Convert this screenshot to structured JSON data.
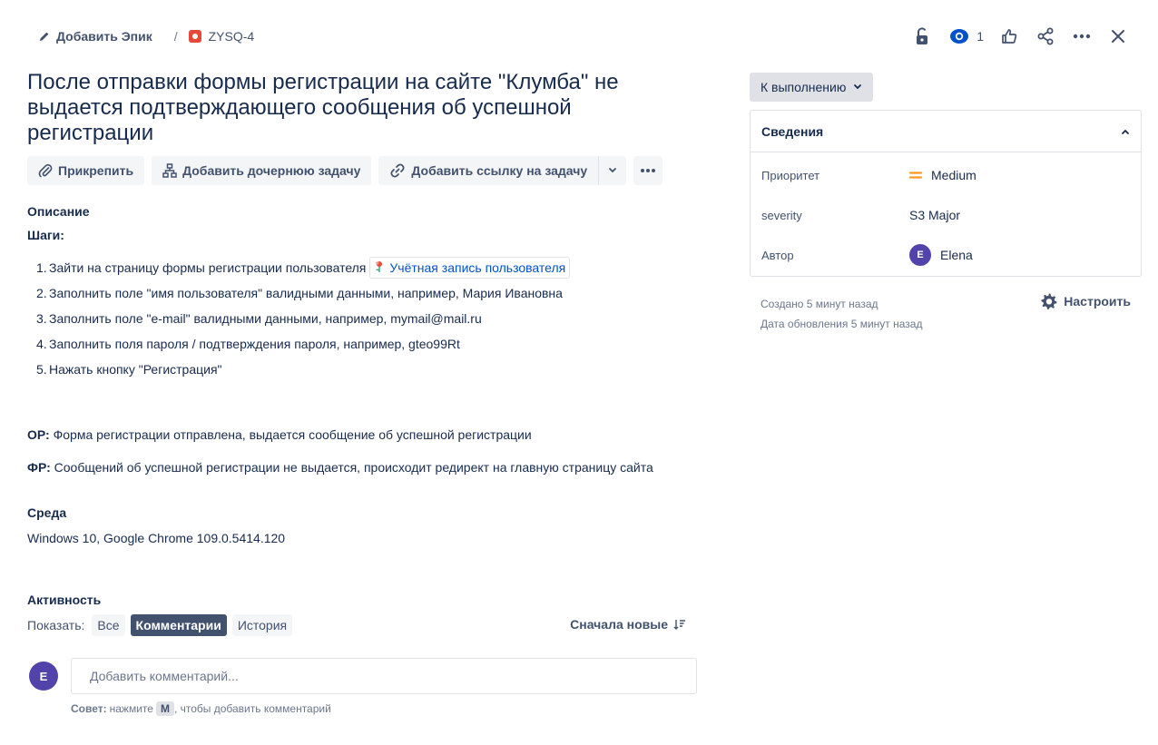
{
  "breadcrumb": {
    "add_epic_label": "Добавить Эпик",
    "separator": "/",
    "issue_key": "ZYSQ-4",
    "issue_type_icon": "bug-icon"
  },
  "header_actions": {
    "watch_count": "1",
    "icons": [
      "unlock-icon",
      "eye-icon",
      "thumbs-up-icon",
      "share-icon",
      "more-icon",
      "close-icon"
    ]
  },
  "issue": {
    "title": "После отправки формы регистрации на сайте \"Клумба\" не выдается подтверждающего сообщения об успешной регистрации"
  },
  "actions": {
    "attach": "Прикрепить",
    "add_child": "Добавить дочернюю задачу",
    "add_link": "Добавить ссылку на задачу"
  },
  "description": {
    "heading": "Описание",
    "steps_heading": "Шаги:",
    "steps": [
      {
        "num": "1.",
        "text": "Зайти на страницу формы регистрации пользователя",
        "link": "Учётная запись пользователя"
      },
      {
        "num": "2.",
        "text": "Заполнить поле \"имя пользователя\" валидными данными, например, Мария Ивановна"
      },
      {
        "num": "3.",
        "text": "Заполнить поле \"e-mail\" валидными данными, например, mymail@mail.ru"
      },
      {
        "num": "4.",
        "text": "Заполнить поля пароля / подтверждения пароля, например, gteo99Rt"
      },
      {
        "num": "5.",
        "text": "Нажать кнопку \"Регистрация\""
      }
    ],
    "expected_label": "ОР:",
    "expected_text": "Форма регистрации отправлена, выдается сообщение об успешной регистрации",
    "actual_label": "ФР:",
    "actual_text": "Сообщений об успешной регистрации не выдается, происходит редирект на главную страницу сайта"
  },
  "environment": {
    "heading": "Среда",
    "value": "Windows 10, Google Chrome 109.0.5414.120"
  },
  "activity": {
    "heading": "Активность",
    "show_label": "Показать:",
    "filters": [
      "Все",
      "Комментарии",
      "История"
    ],
    "active_filter": "Комментарии",
    "sort_label": "Сначала новые",
    "avatar_initial": "E",
    "comment_placeholder": "Добавить комментарий...",
    "tip_prefix": "Совет:",
    "tip_press": "нажмите",
    "tip_key": "M",
    "tip_suffix": ", чтобы добавить комментарий"
  },
  "sidebar": {
    "status": "К выполнению",
    "details_heading": "Сведения",
    "fields": {
      "priority_label": "Приоритет",
      "priority_value": "Medium",
      "priority_color": "#ff991f",
      "severity_label": "severity",
      "severity_value": "S3 Major",
      "author_label": "Автор",
      "author_initial": "E",
      "author_name": "Elena"
    },
    "created": "Создано 5 минут назад",
    "updated": "Дата обновления 5 минут назад",
    "configure_label": "Настроить"
  },
  "colors": {
    "accent": "#0052cc",
    "text": "#172b4d",
    "subtle": "#42526e",
    "avatar": "#5243aa",
    "bug": "#e5493a"
  }
}
